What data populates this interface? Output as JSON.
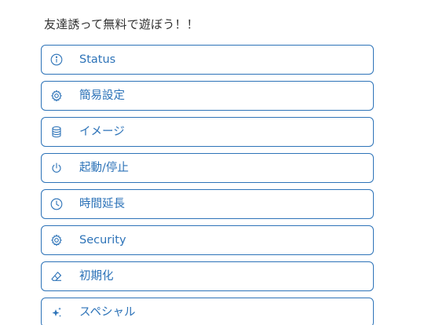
{
  "heading": "友達誘って無料で遊ぼう！！",
  "accent_color": "#2d73b8",
  "menu": {
    "items": [
      {
        "label": "Status",
        "icon": "info-icon"
      },
      {
        "label": "簡易設定",
        "icon": "gear-icon"
      },
      {
        "label": "イメージ",
        "icon": "database-icon"
      },
      {
        "label": "起動/停止",
        "icon": "power-icon"
      },
      {
        "label": "時間延長",
        "icon": "clock-icon"
      },
      {
        "label": "Security",
        "icon": "gear-icon"
      },
      {
        "label": "初期化",
        "icon": "eraser-icon"
      },
      {
        "label": "スペシャル",
        "icon": "sparkles-icon"
      }
    ]
  }
}
